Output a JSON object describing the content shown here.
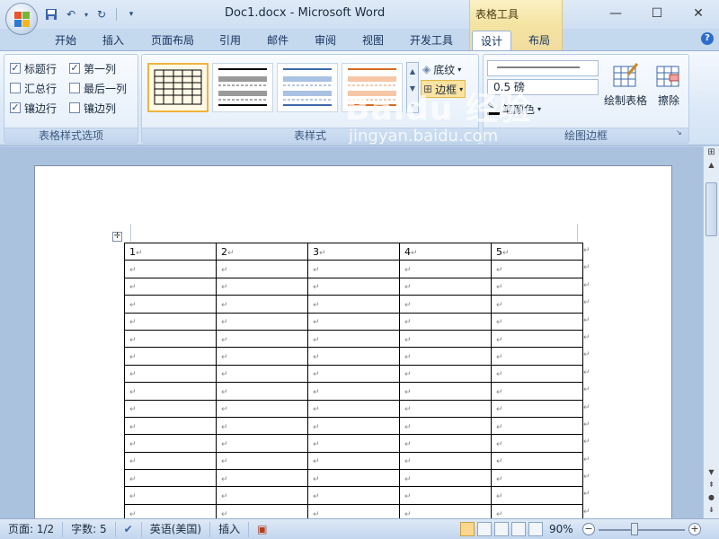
{
  "window": {
    "title": "Doc1.docx - Microsoft Word",
    "context_group": "表格工具"
  },
  "tabs": [
    "开始",
    "插入",
    "页面布局",
    "引用",
    "邮件",
    "审阅",
    "视图",
    "开发工具",
    "设计",
    "布局"
  ],
  "active_tab": "设计",
  "ribbon": {
    "style_options": {
      "label": "表格样式选项",
      "options": [
        {
          "label": "标题行",
          "checked": true
        },
        {
          "label": "第一列",
          "checked": true
        },
        {
          "label": "汇总行",
          "checked": false
        },
        {
          "label": "最后一列",
          "checked": false
        },
        {
          "label": "镶边行",
          "checked": true
        },
        {
          "label": "镶边列",
          "checked": false
        }
      ]
    },
    "table_styles": {
      "label": "表样式",
      "shading": "底纹",
      "borders": "边框"
    },
    "draw_borders": {
      "label": "绘图边框",
      "line_weight": "0.5 磅",
      "pen_color": "笔颜色",
      "draw_table": "绘制表格",
      "eraser": "擦除"
    }
  },
  "table": {
    "header": [
      "1",
      "2",
      "3",
      "4",
      "5"
    ],
    "empty_rows": 15
  },
  "status": {
    "page": "页面: 1/2",
    "words": "字数: 5",
    "language": "英语(美国)",
    "mode": "插入",
    "zoom": "90%"
  },
  "watermark": {
    "text": "Baidu 经验",
    "url": "jingyan.baidu.com"
  },
  "colors": {
    "ribbon_bg": "#dde9f7",
    "context_tab": "#f4e3a2",
    "active_style_border": "#f0b43c"
  }
}
